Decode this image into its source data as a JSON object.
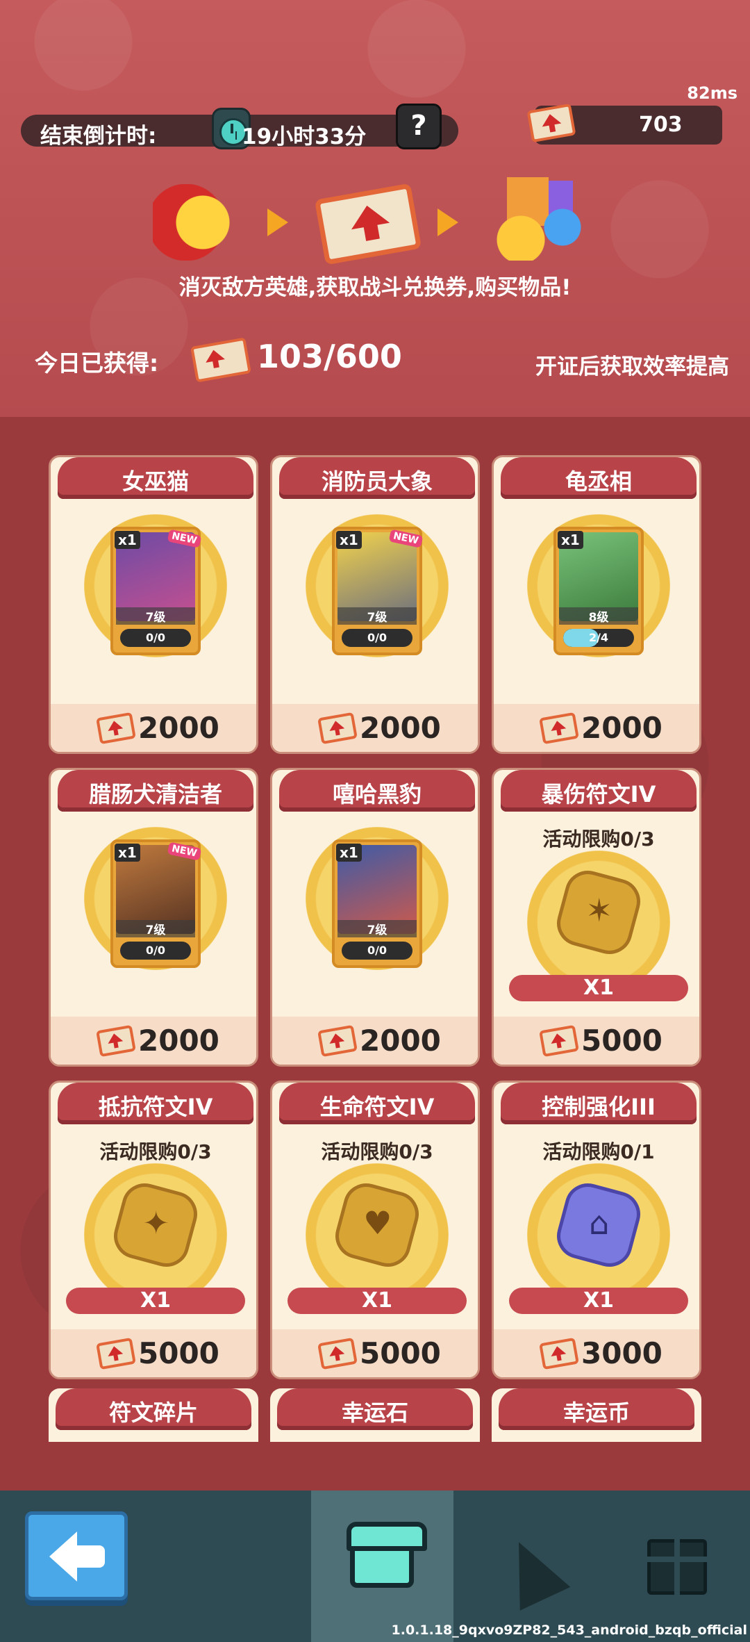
{
  "header": {
    "ping": "82ms",
    "countdown_label": "结束倒计时:",
    "countdown_value": "19小时33分",
    "help_label": "?",
    "ticket_balance": "703",
    "flow_text": "消灭敌方英雄,获取战斗兑换券,购买物品!",
    "today_label": "今日已获得:",
    "today_value": "103/600",
    "license_text": "开证后获取效率提高"
  },
  "items": [
    {
      "name": "女巫猫",
      "type": "hero",
      "qty": "x1",
      "new": "NEW",
      "level": "7级",
      "progress": "0/0",
      "progress_fraction": 0,
      "price": "2000"
    },
    {
      "name": "消防员大象",
      "type": "hero",
      "qty": "x1",
      "new": "NEW",
      "level": "7级",
      "progress": "0/0",
      "progress_fraction": 0,
      "price": "2000"
    },
    {
      "name": "龟丞相",
      "type": "hero",
      "qty": "x1",
      "new": "",
      "level": "8级",
      "progress": "2/4",
      "progress_fraction": 0.5,
      "price": "2000"
    },
    {
      "name": "腊肠犬清洁者",
      "type": "hero",
      "qty": "x1",
      "new": "NEW",
      "level": "7级",
      "progress": "0/0",
      "progress_fraction": 0,
      "price": "2000"
    },
    {
      "name": "嘻哈黑豹",
      "type": "hero",
      "qty": "x1",
      "new": "",
      "level": "7级",
      "progress": "0/0",
      "progress_fraction": 0,
      "price": "2000"
    },
    {
      "name": "暴伤符文IV",
      "type": "rune",
      "limit": "活动限购0/3",
      "qty": "X1",
      "price": "5000"
    },
    {
      "name": "抵抗符文IV",
      "type": "rune",
      "limit": "活动限购0/3",
      "qty": "X1",
      "price": "5000"
    },
    {
      "name": "生命符文IV",
      "type": "rune",
      "limit": "活动限购0/3",
      "qty": "X1",
      "price": "5000"
    },
    {
      "name": "控制强化III",
      "type": "rune",
      "limit": "活动限购0/1",
      "qty": "X1",
      "price": "3000"
    }
  ],
  "partial_items": [
    "符文碎片",
    "幸运石",
    "幸运币"
  ],
  "nav": {
    "back": "back-arrow-icon",
    "shop": "shop-icon",
    "party": "party-popper-icon",
    "gift": "gift-icon"
  },
  "build_text": "1.0.1.18_9qxvo9ZP82_543_android_bzqb_official",
  "colors": {
    "header_bg": "#c55b5c",
    "shop_bg": "#9a3a3d",
    "card_bg": "#fbf1dc",
    "card_header": "#b8444a",
    "nav_bg": "#2e4a52",
    "nav_active": "#4f7077"
  }
}
